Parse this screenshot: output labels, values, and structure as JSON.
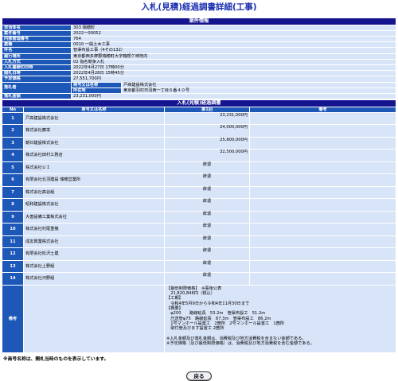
{
  "page_title": "入札(見積)経過調書詳細(工事)",
  "case_section": {
    "header": "案件情報",
    "rows": [
      {
        "label": "自治体名",
        "value": "303 瑞穂町"
      },
      {
        "label": "案件番号",
        "value": "2022ー00052"
      },
      {
        "label": "内部管理番号",
        "value": "764"
      },
      {
        "label": "業種",
        "value": "0010 一般土木工事"
      },
      {
        "label": "件名",
        "value": "管渠布設工事（4その132）"
      },
      {
        "label": "履行場所",
        "value": "東京都西多摩郡瑞穂町大字箱根ケ崎地内"
      },
      {
        "label": "入札方式",
        "value": "02 指名競争入札"
      },
      {
        "label": "入札書締切日時",
        "value": "2022年4月27日 17時00分"
      },
      {
        "label": "開札日時",
        "value": "2022年4月28日 15時45分"
      },
      {
        "label": "予定価格",
        "value": "27,551,700円"
      }
    ],
    "winner": {
      "label": "落札者",
      "name_label": "商号又は名称",
      "name_value": "戸高建設株式会社",
      "addr_label": "所在地",
      "addr_value": "東京都羽村市羽西一丁目６番４０号"
    },
    "award_amount": {
      "label": "落札金額",
      "value": "23,231,000円"
    }
  },
  "bid_section": {
    "header": "入札(見積)経過調書",
    "col_no": "No",
    "col_name": "商号又は名称",
    "col_round": "第1回",
    "col_remarks": "備考",
    "rows": [
      {
        "no": "1",
        "name": "戸高建設株式会社",
        "bid": "23,231,000円"
      },
      {
        "no": "2",
        "name": "株式会社廣栄",
        "bid": "24,000,000円"
      },
      {
        "no": "3",
        "name": "朝日建設株式会社",
        "bid": "25,800,000円"
      },
      {
        "no": "4",
        "name": "株式会社田村工務店",
        "bid": "32,500,000円"
      },
      {
        "no": "5",
        "name": "株式会社ＵＩ",
        "bid": "辞退"
      },
      {
        "no": "6",
        "name": "有限会社北羽建設 瑞穂営業所",
        "bid": "辞退"
      },
      {
        "no": "7",
        "name": "株式会社高谷組",
        "bid": "辞退"
      },
      {
        "no": "8",
        "name": "昭和建設株式会社",
        "bid": "辞退"
      },
      {
        "no": "9",
        "name": "大善設備工業株式会社",
        "bid": "辞退"
      },
      {
        "no": "10",
        "name": "株式会社村尾重機",
        "bid": "辞退"
      },
      {
        "no": "11",
        "name": "成友興業株式会社",
        "bid": "辞退"
      },
      {
        "no": "12",
        "name": "有限会社松沢土建",
        "bid": "辞退"
      },
      {
        "no": "13",
        "name": "株式会社上野組",
        "bid": "辞退"
      },
      {
        "no": "14",
        "name": "株式会社河野組",
        "bid": "辞退"
      }
    ],
    "remarks_label": "備考",
    "remarks_text": "【最低制限価格】　※事後公表\n　21,820,846円（税込）\n【工期】\n　令和4年5月9日から令和4年11月30日まで\n【概要】\n　φ200　　路線延長　53.2m　管渠布設工　51.2m\n　圧送管φ75　路線延長　87.3m　管渠布設工　86.2m\n　1号マンホール設置工　2箇所　2号マンホール設置工　1箇所\n　取付管及びます設置工 2箇所\n\n※入札金額及び落札金額は、消費税及び地方消費税を含まない金額である。\n※予定価格（及び最低制限価格）は、消費税及び地方消費税を含む金額である。"
  },
  "footnote": "※商号名称は、開札当時のものを表示しています。",
  "back_button": "戻る"
}
